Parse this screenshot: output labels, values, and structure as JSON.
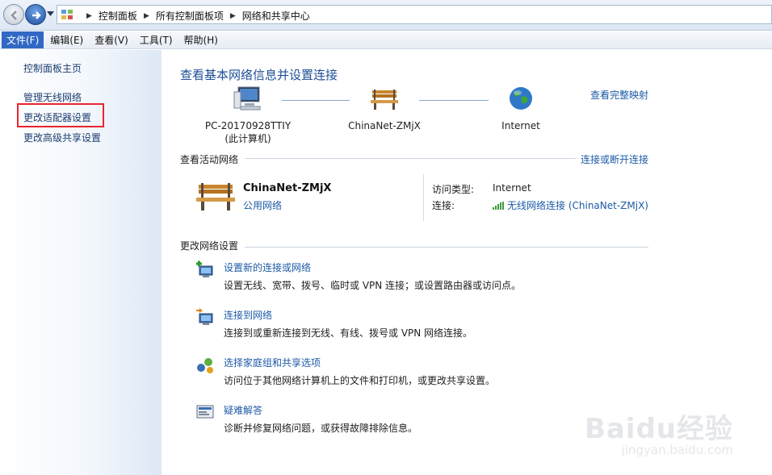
{
  "breadcrumb": [
    "控制面板",
    "所有控制面板项",
    "网络和共享中心"
  ],
  "menu": [
    "文件(F)",
    "编辑(E)",
    "查看(V)",
    "工具(T)",
    "帮助(H)"
  ],
  "sidebar": {
    "items": [
      "控制面板主页",
      "管理无线网络",
      "更改适配器设置",
      "更改高级共享设置"
    ]
  },
  "main": {
    "title": "查看基本网络信息并设置连接",
    "map_link": "查看完整映射",
    "map": {
      "computer_name": "PC-20170928TTIY",
      "computer_sub": "(此计算机)",
      "network_name": "ChinaNet-ZMjX",
      "internet_label": "Internet"
    },
    "active": {
      "label": "查看活动网络",
      "connect_link": "连接或断开连接",
      "network_name": "ChinaNet-ZMjX",
      "network_type": "公用网络",
      "access_key": "访问类型:",
      "access_val": "Internet",
      "conn_key": "连接:",
      "conn_val": "无线网络连接 (ChinaNet-ZMjX)"
    },
    "settings": {
      "label": "更改网络设置",
      "tasks": [
        {
          "title": "设置新的连接或网络",
          "desc": "设置无线、宽带、拨号、临时或 VPN 连接；或设置路由器或访问点。"
        },
        {
          "title": "连接到网络",
          "desc": "连接到或重新连接到无线、有线、拨号或 VPN 网络连接。"
        },
        {
          "title": "选择家庭组和共享选项",
          "desc": "访问位于其他网络计算机上的文件和打印机，或更改共享设置。"
        },
        {
          "title": "疑难解答",
          "desc": "诊断并修复网络问题，或获得故障排除信息。"
        }
      ]
    }
  },
  "watermark": {
    "main": "Baidu经验",
    "sub": "jingyan.baidu.com"
  },
  "colors": {
    "link": "#1c5aa6",
    "title": "#1e4f96",
    "highlight": "#e8262b",
    "menu_active": "#3168c4"
  }
}
